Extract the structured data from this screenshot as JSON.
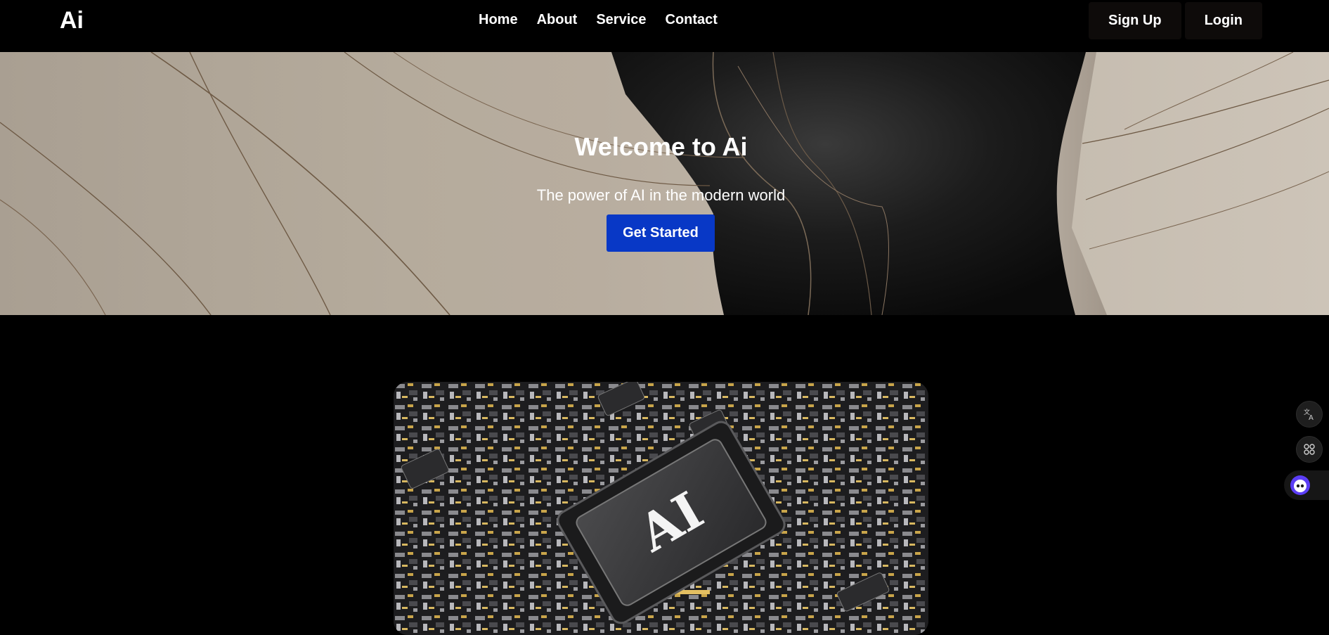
{
  "header": {
    "logo": "Ai",
    "nav": [
      {
        "label": "Home"
      },
      {
        "label": "About"
      },
      {
        "label": "Service"
      },
      {
        "label": "Contact"
      }
    ],
    "signup_label": "Sign Up",
    "login_label": "Login"
  },
  "hero": {
    "title": "Welcome to Ai",
    "subtitle": "The power of AI in the modern world",
    "cta_label": "Get Started"
  },
  "feature_image": {
    "chip_text": "AI"
  },
  "side_tools": {
    "icons": [
      "translate-icon",
      "apps-grid-icon",
      "assistant-bot-icon"
    ]
  },
  "colors": {
    "background": "#000000",
    "cta": "#0838c6",
    "hero_tone": "#b8ad9f",
    "assistant_accent": "#5b3df5"
  }
}
